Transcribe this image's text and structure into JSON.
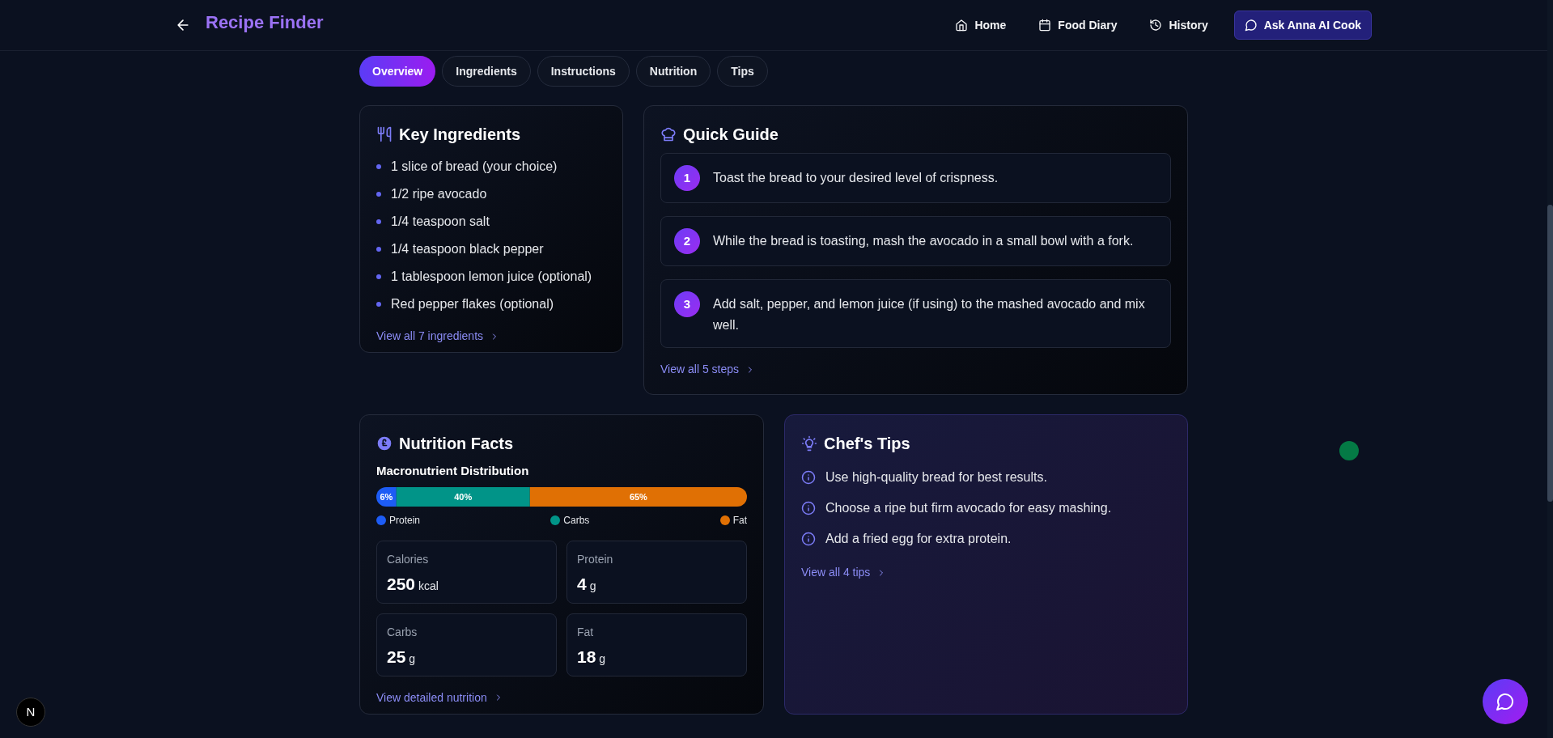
{
  "header": {
    "title": "Recipe Finder",
    "nav": [
      {
        "kind": "home",
        "label": "Home"
      },
      {
        "kind": "diary",
        "label": "Food Diary"
      },
      {
        "kind": "history",
        "label": "History"
      }
    ],
    "cta": "Ask Anna AI Cook"
  },
  "tabs": [
    {
      "label": "Overview",
      "selected": true
    },
    {
      "label": "Ingredients",
      "selected": false
    },
    {
      "label": "Instructions",
      "selected": false
    },
    {
      "label": "Nutrition",
      "selected": false
    },
    {
      "label": "Tips",
      "selected": false
    }
  ],
  "ingredients": {
    "title": "Key Ingredients",
    "items": [
      "1 slice of bread (your choice)",
      "1/2 ripe avocado",
      "1/4 teaspoon salt",
      "1/4 teaspoon black pepper",
      "1 tablespoon lemon juice (optional)",
      "Red pepper flakes (optional)"
    ],
    "link": "View all 7 ingredients"
  },
  "guide": {
    "title": "Quick Guide",
    "steps": [
      {
        "number": "1",
        "text": "Toast the bread to your desired level of crispness."
      },
      {
        "number": "2",
        "text": "While the bread is toasting, mash the avocado in a small bowl with a fork."
      },
      {
        "number": "3",
        "text": "Add salt, pepper, and lemon juice (if using) to the mashed avocado and mix well."
      }
    ],
    "link": "View all 5 steps"
  },
  "nutrition": {
    "title": "Nutrition Facts",
    "chart_data": {
      "type": "bar",
      "title": "Macronutrient Distribution",
      "orientation": "horizontal",
      "stacked": true,
      "legend": "bottom",
      "data_labels": true,
      "series": [
        {
          "name": "Protein",
          "color": "#1d5cf5",
          "values": [
            6
          ],
          "value_labels": [
            "6%"
          ]
        },
        {
          "name": "Carbs",
          "color": "#019488",
          "values": [
            40
          ],
          "value_labels": [
            "40%"
          ]
        },
        {
          "name": "Fat",
          "color": "#e07004",
          "values": [
            65
          ],
          "value_labels": [
            "65%"
          ]
        }
      ]
    },
    "facts": [
      {
        "label": "Calories",
        "value": "250",
        "unit": "kcal"
      },
      {
        "label": "Protein",
        "value": "4",
        "unit": "g"
      },
      {
        "label": "Carbs",
        "value": "25",
        "unit": "g"
      },
      {
        "label": "Fat",
        "value": "18",
        "unit": "g"
      }
    ],
    "link": "View detailed nutrition"
  },
  "tips": {
    "title": "Chef's Tips",
    "items": [
      "Use high-quality bread for best results.",
      "Choose a ripe but firm avocado for easy mashing.",
      "Add a fried egg for extra protein."
    ],
    "link": "View all 4 tips"
  },
  "dev_badge": "N"
}
